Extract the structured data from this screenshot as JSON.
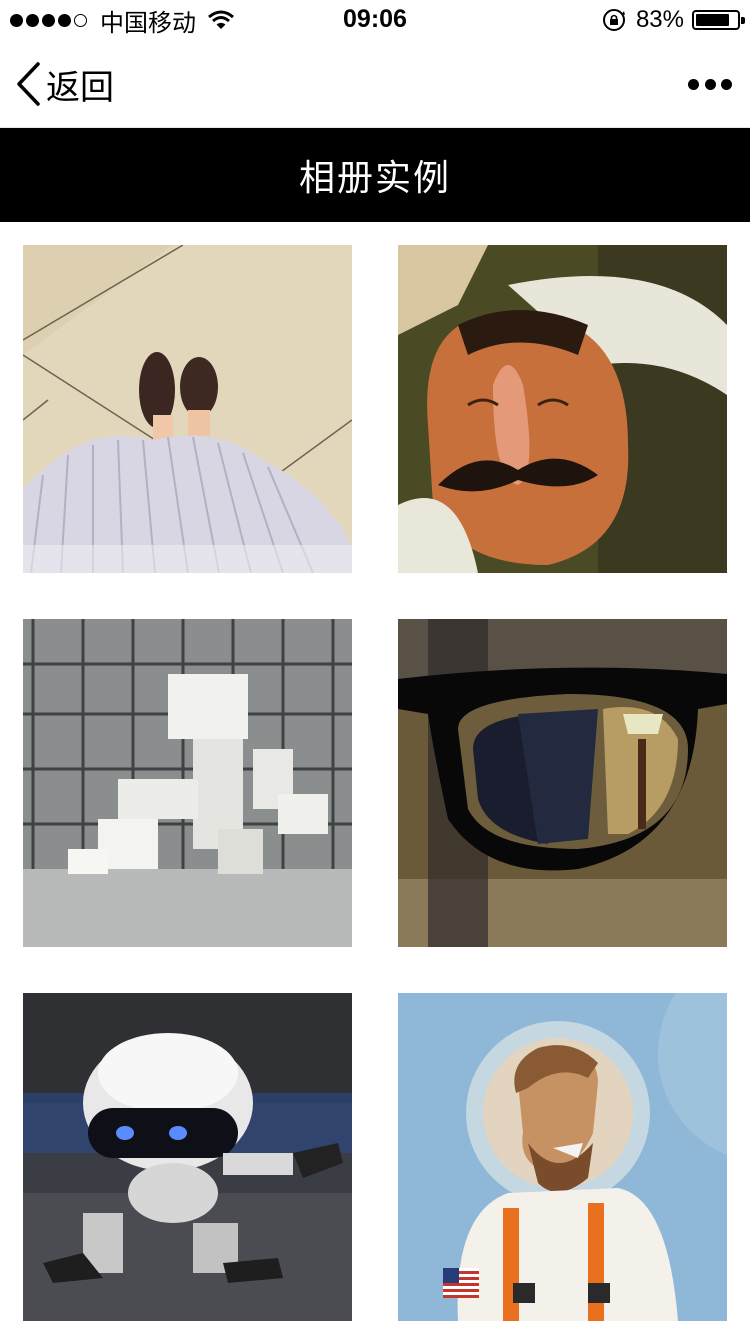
{
  "status_bar": {
    "carrier": "中国移动",
    "time": "09:06",
    "battery_percent": "83%",
    "battery_level": 0.83
  },
  "nav": {
    "back_label": "返回",
    "back_icon": "chevron-left-icon",
    "more_icon": "more-dots-icon"
  },
  "page": {
    "title": "相册实例"
  },
  "photos": [
    {
      "name": "photo-shoes-skirt"
    },
    {
      "name": "photo-mustache-man"
    },
    {
      "name": "photo-box-robot"
    },
    {
      "name": "photo-glasses"
    },
    {
      "name": "photo-white-robot"
    },
    {
      "name": "photo-astronaut-man"
    }
  ]
}
